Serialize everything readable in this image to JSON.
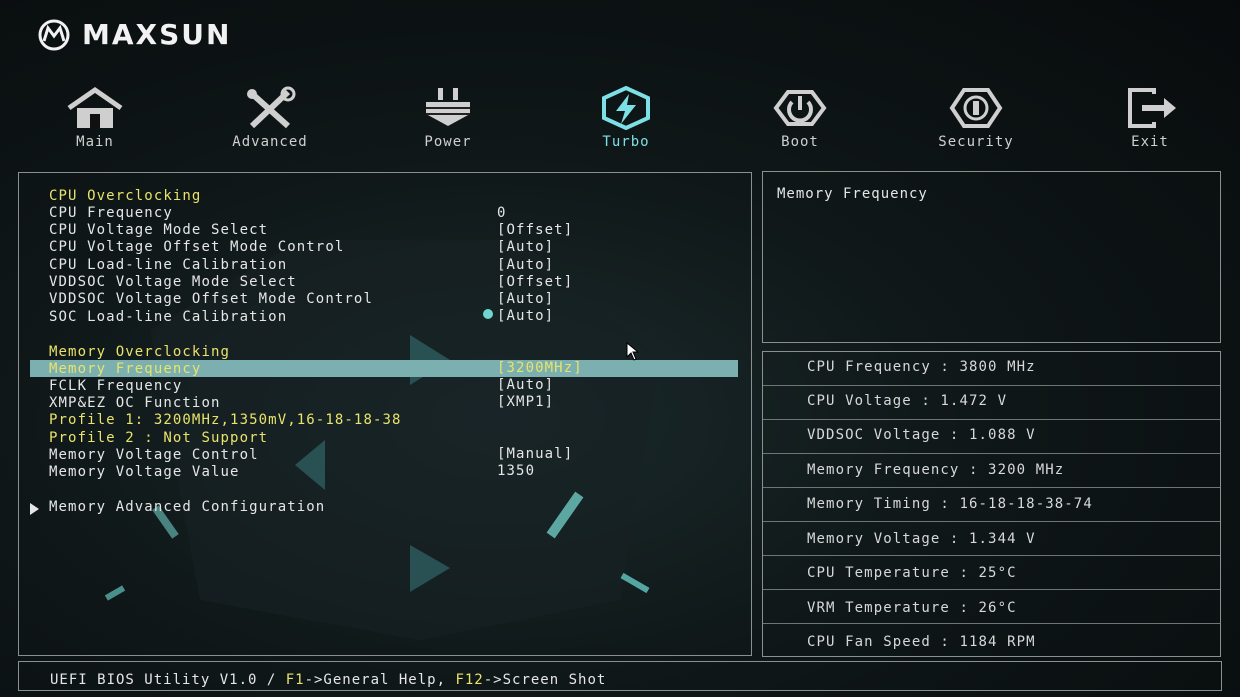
{
  "brand": {
    "name": "MAXSUN"
  },
  "nav": [
    {
      "label": "Main",
      "icon": "home-icon"
    },
    {
      "label": "Advanced",
      "icon": "tools-icon"
    },
    {
      "label": "Power",
      "icon": "power-supply-icon"
    },
    {
      "label": "Turbo",
      "icon": "lightning-icon"
    },
    {
      "label": "Boot",
      "icon": "power-icon"
    },
    {
      "label": "Security",
      "icon": "shield-icon"
    },
    {
      "label": "Exit",
      "icon": "exit-icon"
    }
  ],
  "active_tab": "Turbo",
  "settings": {
    "cpu_section": "CPU Overclocking",
    "cpu_frequency": {
      "label": "CPU Frequency",
      "value": "0"
    },
    "cpu_voltage_mode": {
      "label": "CPU Voltage Mode Select",
      "value": "[Offset]"
    },
    "cpu_voltage_offset": {
      "label": "CPU Voltage Offset Mode Control",
      "value": "[Auto]"
    },
    "cpu_llc": {
      "label": "CPU Load-line Calibration",
      "value": "[Auto]"
    },
    "vddsoc_mode": {
      "label": "VDDSOC Voltage Mode Select",
      "value": "[Offset]"
    },
    "vddsoc_offset": {
      "label": "VDDSOC Voltage Offset Mode Control",
      "value": "[Auto]"
    },
    "soc_llc": {
      "label": "SOC Load-line Calibration",
      "value": "[Auto]"
    },
    "mem_section": "Memory Overclocking",
    "mem_frequency": {
      "label": "Memory Frequency",
      "value": "[3200MHz]"
    },
    "fclk": {
      "label": "FCLK Frequency",
      "value": "[Auto]"
    },
    "xmp": {
      "label": "XMP&EZ OC Function",
      "value": "[XMP1]"
    },
    "profile1": "Profile 1: 3200MHz,1350mV,16-18-18-38",
    "profile2": "Profile 2 : Not Support",
    "mem_voltage_control": {
      "label": "Memory Voltage Control",
      "value": "[Manual]"
    },
    "mem_voltage_value": {
      "label": "Memory Voltage Value",
      "value": "1350"
    },
    "mem_advanced": "Memory Advanced Configuration"
  },
  "help": {
    "title": "Memory Frequency"
  },
  "status": [
    "CPU Frequency : 3800 MHz",
    "CPU Voltage : 1.472 V",
    "VDDSOC Voltage : 1.088 V",
    "Memory Frequency : 3200 MHz",
    "Memory Timing : 16-18-18-38-74",
    "Memory Voltage : 1.344 V",
    "CPU Temperature : 25°C",
    "VRM Temperature : 26°C",
    "CPU Fan Speed : 1184 RPM"
  ],
  "footer": {
    "prefix": "UEFI BIOS Utility V1.0 / ",
    "f1_key": "F1",
    "f1_text": "->General Help, ",
    "f12_key": "F12",
    "f12_text": "->Screen Shot"
  },
  "colors": {
    "accent_yellow": "#e8e36a",
    "highlight": "#7cb0b0",
    "turbo": "#7de0e6"
  }
}
